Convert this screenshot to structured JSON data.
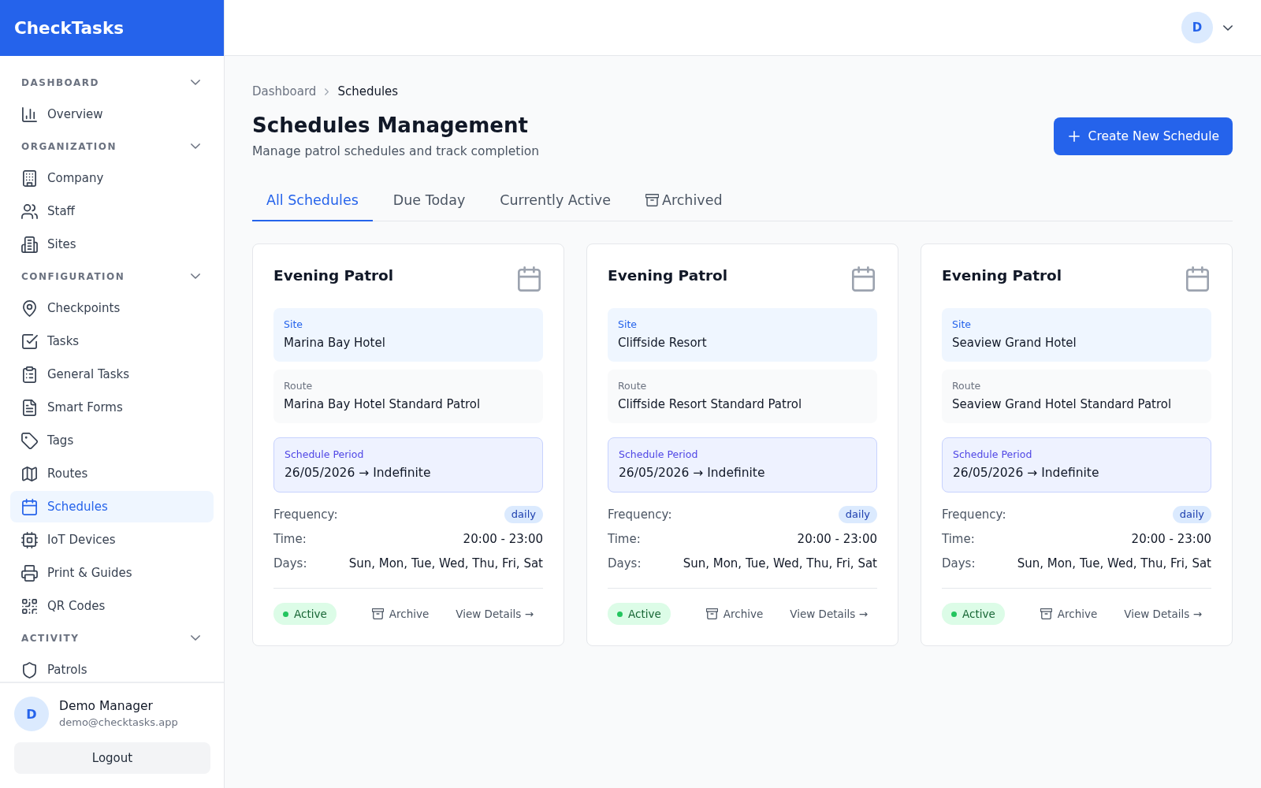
{
  "sidebar": {
    "logo": "CheckTasks",
    "sections": [
      {
        "title": "DASHBOARD",
        "expanded": true,
        "items": [
          {
            "label": "Overview",
            "selected": false
          }
        ]
      },
      {
        "title": "ORGANIZATION",
        "expanded": true,
        "items": [
          {
            "label": "Company",
            "selected": false
          },
          {
            "label": "Staff",
            "selected": false
          },
          {
            "label": "Sites",
            "selected": false
          }
        ]
      },
      {
        "title": "CONFIGURATION",
        "expanded": true,
        "items": [
          {
            "label": "Checkpoints",
            "selected": false
          },
          {
            "label": "Tasks",
            "selected": false
          },
          {
            "label": "General Tasks",
            "selected": false
          },
          {
            "label": "Smart Forms",
            "selected": false
          },
          {
            "label": "Tags",
            "selected": false
          },
          {
            "label": "Routes",
            "selected": false
          },
          {
            "label": "Schedules",
            "selected": true
          },
          {
            "label": "IoT Devices",
            "selected": false
          },
          {
            "label": "Print & Guides",
            "selected": false
          },
          {
            "label": "QR Codes",
            "selected": false
          }
        ]
      },
      {
        "title": "ACTIVITY",
        "expanded": true,
        "items": [
          {
            "label": "Patrols",
            "selected": false
          }
        ]
      }
    ],
    "user": {
      "initial": "D",
      "name": "Demo Manager",
      "email": "demo@checktasks.app"
    },
    "logout_button": "Logout"
  },
  "top_bar": {
    "avatar_initial": "D"
  },
  "breadcrumb": [
    {
      "label": "Dashboard",
      "current": false
    },
    {
      "label": "Schedules",
      "current": true
    }
  ],
  "header": {
    "title": "Schedules Management",
    "subtitle": "Manage patrol schedules and track completion",
    "create_button": "Create New Schedule"
  },
  "tabs": [
    {
      "label": "All Schedules",
      "selected": true,
      "kind": "text"
    },
    {
      "label": "Due Today",
      "selected": false,
      "kind": "text"
    },
    {
      "label": "Currently Active",
      "selected": false,
      "kind": "text"
    },
    {
      "label": "Archived",
      "selected": false,
      "kind": "archive"
    }
  ],
  "cards": [
    {
      "title": "Evening Patrol",
      "site_label": "Site",
      "site": "Marina Bay Hotel",
      "route_label": "Route",
      "route": "Marina Bay Hotel Standard Patrol",
      "period_label": "Schedule Period",
      "period": "26/05/2026 → Indefinite",
      "frequency_label": "Frequency:",
      "frequency": "daily",
      "time_label": "Time:",
      "time": "20:00 - 23:00",
      "days_label": "Days:",
      "days": "Sun, Mon, Tue, Wed, Thu, Fri, Sat",
      "status": "Active",
      "active": true,
      "archive_button": "Archive",
      "details_link": "View Details →"
    },
    {
      "title": "Evening Patrol",
      "site_label": "Site",
      "site": "Cliffside Resort",
      "route_label": "Route",
      "route": "Cliffside Resort Standard Patrol",
      "period_label": "Schedule Period",
      "period": "26/05/2026 → Indefinite",
      "frequency_label": "Frequency:",
      "frequency": "daily",
      "time_label": "Time:",
      "time": "20:00 - 23:00",
      "days_label": "Days:",
      "days": "Sun, Mon, Tue, Wed, Thu, Fri, Sat",
      "status": "Active",
      "active": true,
      "archive_button": "Archive",
      "details_link": "View Details →"
    },
    {
      "title": "Evening Patrol",
      "site_label": "Site",
      "site": "Seaview Grand Hotel",
      "route_label": "Route",
      "route": "Seaview Grand Hotel Standard Patrol",
      "period_label": "Schedule Period",
      "period": "26/05/2026 → Indefinite",
      "frequency_label": "Frequency:",
      "frequency": "daily",
      "time_label": "Time:",
      "time": "20:00 - 23:00",
      "days_label": "Days:",
      "days": "Sun, Mon, Tue, Wed, Thu, Fri, Sat",
      "status": "Active",
      "active": true,
      "archive_button": "Archive",
      "details_link": "View Details →"
    }
  ]
}
